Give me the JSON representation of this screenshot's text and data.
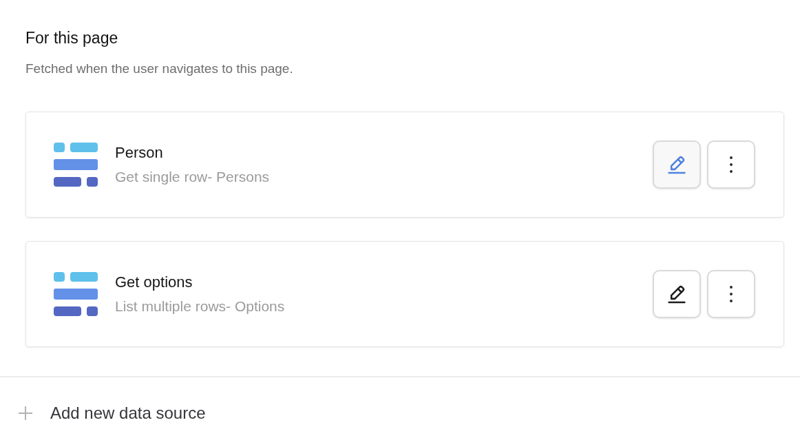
{
  "section": {
    "title": "For this page",
    "description": "Fetched when the user navigates to this page."
  },
  "data_sources": [
    {
      "name": "Person",
      "subtitle": "Get single row- Persons",
      "edit_hovered": true
    },
    {
      "name": "Get options",
      "subtitle": "List multiple rows- Options",
      "edit_hovered": false
    }
  ],
  "add_button": {
    "label": "Add new data source"
  }
}
